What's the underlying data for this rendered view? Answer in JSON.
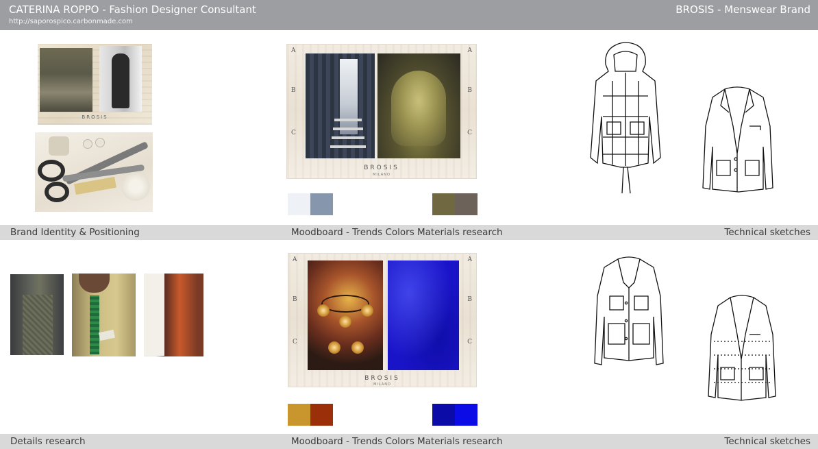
{
  "header": {
    "designer": "CATERINA ROPPO",
    "separator": " - ",
    "role": "Fashion Designer Consultant",
    "url": "http://saporospico.carbonmade.com",
    "brand": "BROSIS - Menswear Brand"
  },
  "row1": {
    "caption_left": "Brand Identity & Positioning",
    "caption_mid": "Moodboard - Trends Colors Materials research",
    "caption_right": "Technical sketches",
    "moodboard": {
      "marks": [
        "A",
        "B",
        "C"
      ],
      "logo": "BROSIS",
      "logo_sub": "MILANO"
    },
    "collage_logo": "BROSIS",
    "swatches": [
      "#eef1f5",
      "#8596ad",
      "#6f6840",
      "#6d625a"
    ]
  },
  "row2": {
    "caption_left": "Details research",
    "caption_mid": "Moodboard - Trends Colors Materials research",
    "caption_right": "Technical sketches",
    "moodboard": {
      "marks": [
        "A",
        "B",
        "C"
      ],
      "logo": "BROSIS",
      "logo_sub": "MILANO"
    },
    "swatches": [
      "#c9962e",
      "#9a2f0a",
      "#0b0ba7",
      "#0c0ce6"
    ]
  }
}
